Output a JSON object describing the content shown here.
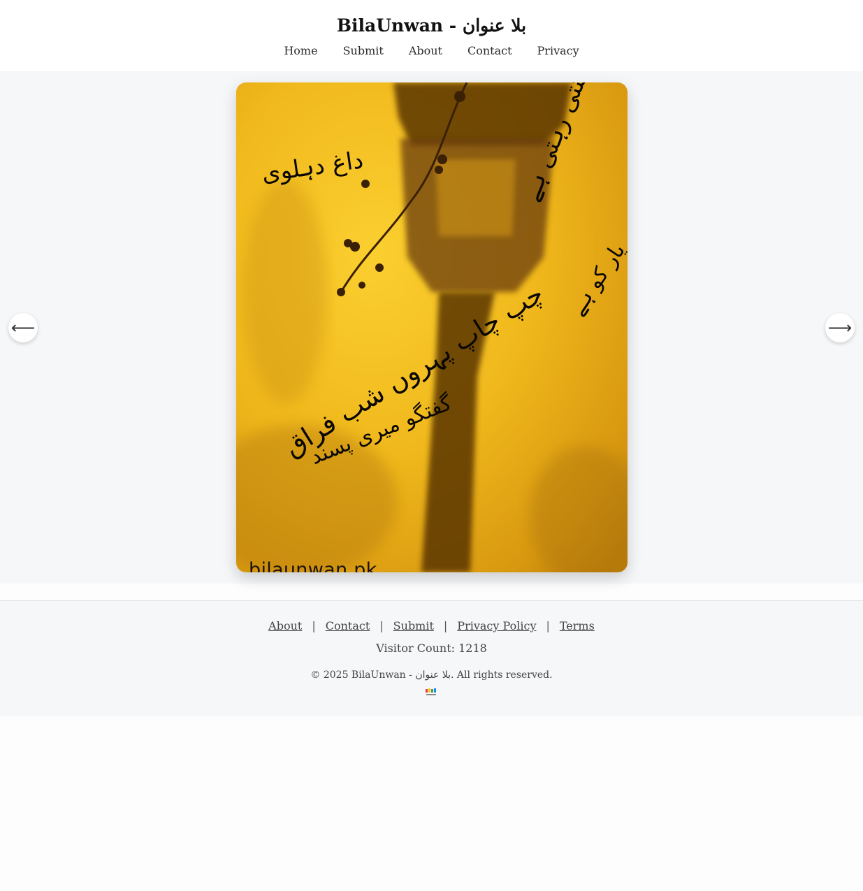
{
  "site": {
    "title": "BilaUnwan - بلا عنوان"
  },
  "nav": {
    "items": [
      "Home",
      "Submit",
      "About",
      "Contact",
      "Privacy"
    ]
  },
  "poster": {
    "poet": "داغ دہلوی",
    "verse_lines": [
      "سنتی رہتی ہے",
      "تصویر یار کو ہے",
      "چپ چاپ پہروں شب فراق",
      "گفتگو میری پسند"
    ],
    "watermark": "bilaunwan.pk",
    "colors": {
      "background": "#f0b81c",
      "shadow": "#5a3406"
    }
  },
  "carousel": {
    "prev_icon": "arrow-left-icon",
    "prev_glyph": "⟵",
    "next_icon": "arrow-right-icon",
    "next_glyph": "⟶"
  },
  "footer": {
    "links": [
      "About",
      "Contact",
      "Submit",
      "Privacy Policy",
      "Terms"
    ],
    "separator": "|",
    "visitor_label": "Visitor Count: 1218",
    "copyright": "© 2025 BilaUnwan - بلا عنوان. All rights reserved.",
    "logo_icon": "bilaunwan-logo-icon"
  }
}
